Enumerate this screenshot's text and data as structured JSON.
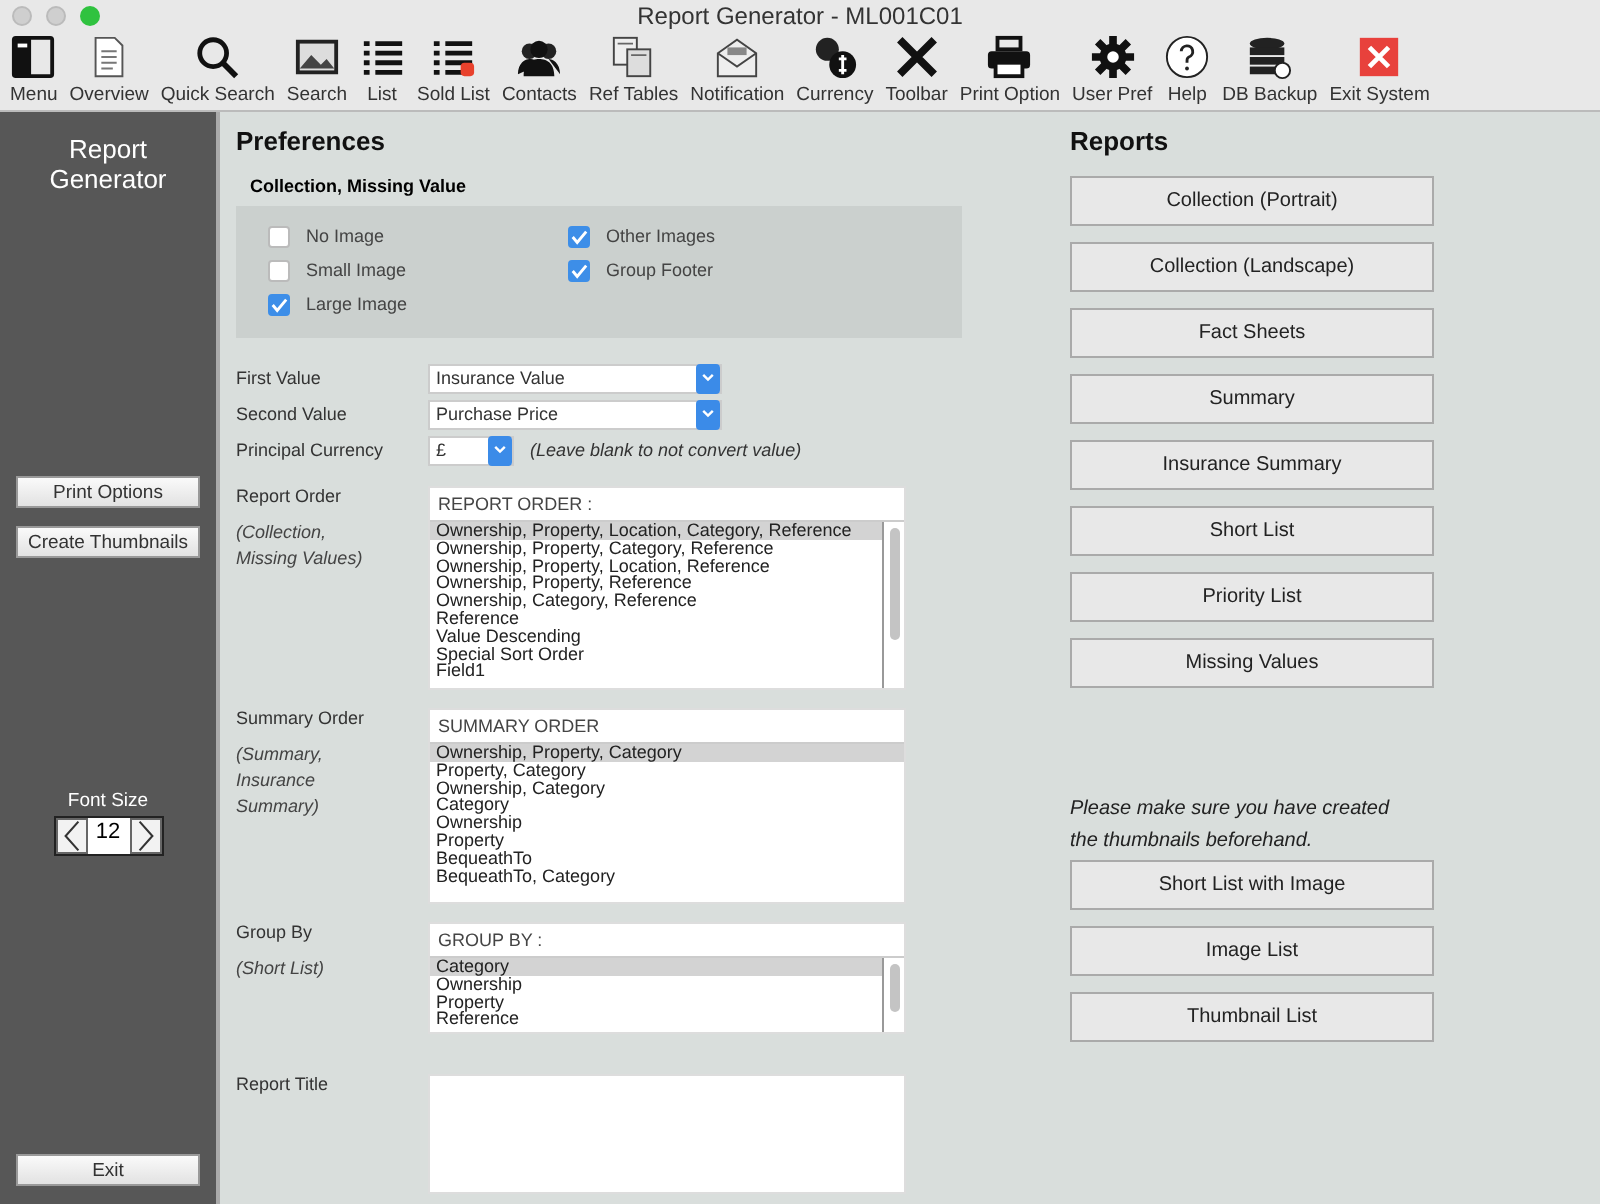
{
  "window": {
    "title": "Report Generator - ML001C01"
  },
  "toolbar": [
    "Menu",
    "Overview",
    "Quick Search",
    "Search",
    "List",
    "Sold List",
    "Contacts",
    "Ref Tables",
    "Notification",
    "Currency",
    "Toolbar",
    "Print Option",
    "User Pref",
    "Help",
    "DB Backup",
    "Exit System"
  ],
  "sidebar": {
    "title": "Report Generator",
    "buttons": [
      "Print Options",
      "Create Thumbnails"
    ],
    "font_size": {
      "label": "Font Size",
      "value": "12"
    },
    "exit": "Exit"
  },
  "preferences": {
    "title": "Preferences",
    "section": "Collection, Missing Value",
    "checkboxes": [
      {
        "label": "No Image",
        "checked": false
      },
      {
        "label": "Small Image",
        "checked": false
      },
      {
        "label": "Large Image",
        "checked": true
      },
      {
        "label": "Other Images",
        "checked": true
      },
      {
        "label": "Group Footer",
        "checked": true
      }
    ],
    "first_value": {
      "label": "First Value",
      "value": "Insurance Value"
    },
    "second_value": {
      "label": "Second Value",
      "value": "Purchase Price"
    },
    "currency": {
      "label": "Principal Currency",
      "value": "£",
      "note": "(Leave blank to not convert value)"
    },
    "lists": [
      {
        "label": "Report Order",
        "note": "(Collection, Missing Values)",
        "header": "REPORT ORDER :",
        "scrollbar": true,
        "items": [
          {
            "text": "Ownership, Property, Location, Category, Reference",
            "selected": true
          },
          {
            "text": "Ownership, Property, Category, Reference",
            "selected": false
          },
          {
            "text": "Ownership, Property, Location, Reference",
            "selected": false
          },
          {
            "text": "Ownership, Property, Reference",
            "selected": false
          },
          {
            "text": "Ownership, Category, Reference",
            "selected": false
          },
          {
            "text": "Reference",
            "selected": false
          },
          {
            "text": "Value Descending",
            "selected": false
          },
          {
            "text": "Special Sort Order",
            "selected": false
          },
          {
            "text": "Field1",
            "selected": false
          }
        ]
      },
      {
        "label": "Summary Order",
        "note": "(Summary, Insurance Summary)",
        "header": "SUMMARY ORDER",
        "scrollbar": false,
        "items": [
          {
            "text": "Ownership, Property, Category",
            "selected": true
          },
          {
            "text": "Property, Category",
            "selected": false
          },
          {
            "text": "Ownership, Category",
            "selected": false
          },
          {
            "text": "Category",
            "selected": false
          },
          {
            "text": "Ownership",
            "selected": false
          },
          {
            "text": "Property",
            "selected": false
          },
          {
            "text": "BequeathTo",
            "selected": false
          },
          {
            "text": "BequeathTo, Category",
            "selected": false
          }
        ]
      },
      {
        "label": "Group By",
        "note": "(Short List)",
        "header": "GROUP BY :",
        "scrollbar": true,
        "items": [
          {
            "text": "Category",
            "selected": true
          },
          {
            "text": "Ownership",
            "selected": false
          },
          {
            "text": "Property",
            "selected": false
          },
          {
            "text": "Reference",
            "selected": false
          }
        ]
      }
    ],
    "report_title": {
      "label": "Report Title"
    }
  },
  "reports": {
    "title": "Reports",
    "buttons": [
      "Collection (Portrait)",
      "Collection (Landscape)",
      "Fact Sheets",
      "Summary",
      "Insurance Summary",
      "Short List",
      "Priority List",
      "Missing Values"
    ],
    "note": "Please make sure you have created the thumbnails beforehand.",
    "image_buttons": [
      "Short List with Image",
      "Image List",
      "Thumbnail List"
    ]
  }
}
